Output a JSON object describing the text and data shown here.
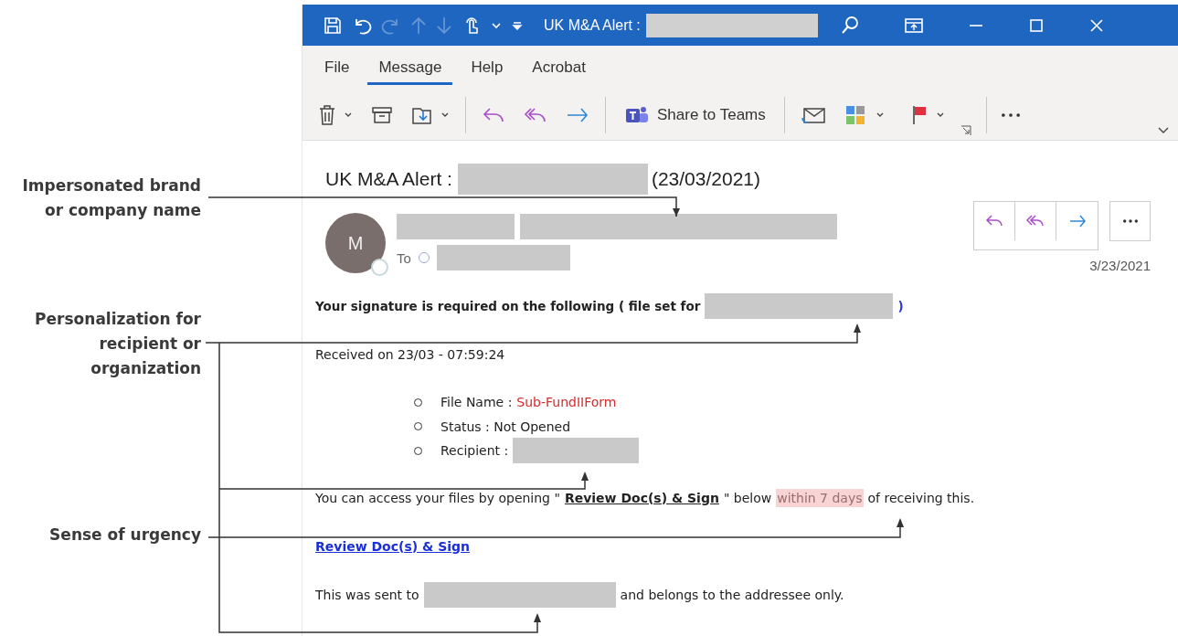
{
  "annotations": [
    {
      "label": "Impersonated brand or company name"
    },
    {
      "label": "Personalization for recipient or organization"
    },
    {
      "label": "Sense of urgency"
    }
  ],
  "window": {
    "title": "UK M&A Alert :",
    "title_redacted": true,
    "quick_access": [
      {
        "disabled": false
      },
      {
        "disabled": false
      },
      {
        "disabled": true
      },
      {
        "disabled": true
      },
      {
        "disabled": true
      },
      {
        "disabled": false
      }
    ]
  },
  "tabs": [
    {
      "label": "File",
      "selected": false
    },
    {
      "label": "Message",
      "selected": true
    },
    {
      "label": "Help",
      "selected": false
    },
    {
      "label": "Acrobat",
      "selected": false
    }
  ],
  "toolbar": {
    "share_label": "Share to Teams"
  },
  "message": {
    "subject": [
      {
        "kind": "text",
        "text": "UK M&A Alert :"
      },
      {
        "kind": "redacted"
      },
      {
        "kind": "text",
        "text": "(23/03/2021)"
      }
    ],
    "avatar_initial": "M",
    "to_label": "To",
    "date": "3/23/2021",
    "body": [
      {
        "kind": "paragraph",
        "bold": true,
        "segments": [
          {
            "kind": "text",
            "text": "Your signature is required on the following ( file set for"
          },
          {
            "kind": "redacted"
          },
          {
            "kind": "text",
            "text": ")",
            "color": "#2f3bd6"
          }
        ]
      },
      {
        "kind": "paragraph",
        "bold": false,
        "segments": [
          {
            "kind": "text",
            "text": "Received on 23/03 - 07:59:24"
          }
        ]
      },
      {
        "kind": "list",
        "items": [
          {
            "segments": [
              {
                "kind": "text",
                "text": "File Name :"
              },
              {
                "kind": "text",
                "text": "Sub-FundIIForm",
                "color": "#d52b2b"
              }
            ]
          },
          {
            "segments": [
              {
                "kind": "text",
                "text": "Status : Not Opened"
              }
            ]
          },
          {
            "segments": [
              {
                "kind": "text",
                "text": "Recipient :"
              },
              {
                "kind": "redacted"
              }
            ]
          }
        ]
      },
      {
        "kind": "paragraph",
        "bold": false,
        "segments": [
          {
            "kind": "text",
            "text": "You can access your files by opening \""
          },
          {
            "kind": "emphasis",
            "text": "Review Doc(s) & Sign"
          },
          {
            "kind": "text",
            "text": "\" below"
          },
          {
            "kind": "highlight",
            "text": "within 7 days"
          },
          {
            "kind": "text",
            "text": "of receiving this."
          }
        ]
      },
      {
        "kind": "paragraph",
        "bold": false,
        "segments": [
          {
            "kind": "link",
            "text": "Review Doc(s) & Sign"
          }
        ]
      },
      {
        "kind": "paragraph",
        "bold": false,
        "segments": [
          {
            "kind": "text",
            "text": "This was sent to"
          },
          {
            "kind": "redacted"
          },
          {
            "kind": "text",
            "text": "and belongs to the addressee only."
          }
        ]
      }
    ]
  }
}
